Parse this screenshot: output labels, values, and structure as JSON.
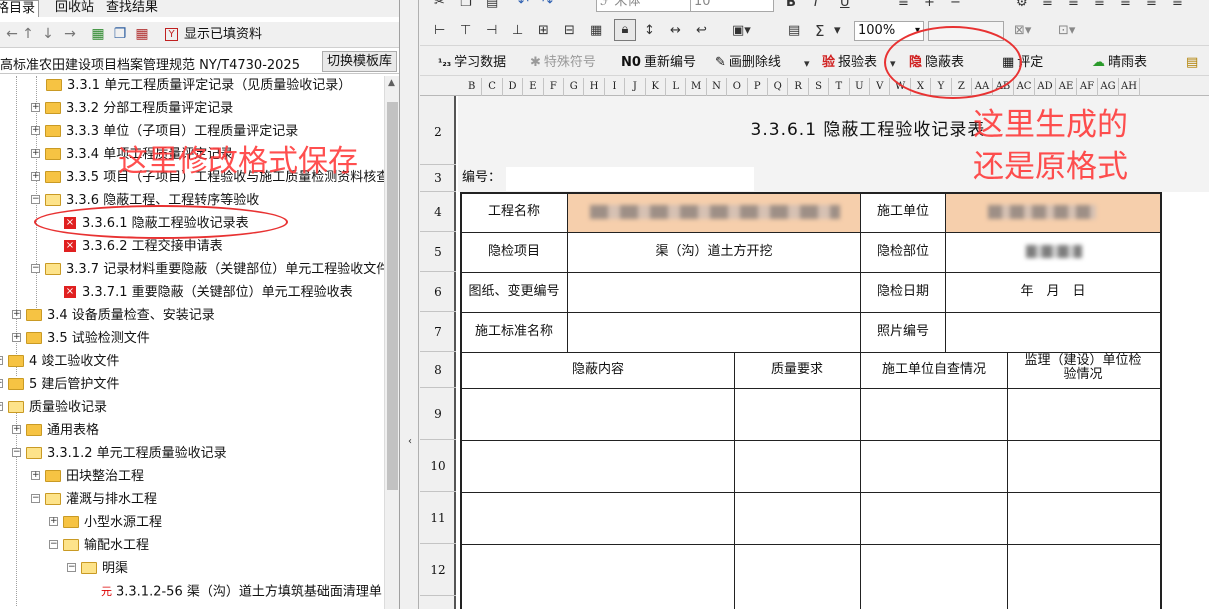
{
  "left_panel": {
    "tabs": [
      "格目录",
      "回收站",
      "查找结果"
    ],
    "show_filled_label": "显示已填资料",
    "standard": "高标准农田建设项目档案管理规范 NY/T4730-2025",
    "switch_template_label": "切换模板库",
    "tree": [
      "3.3.1 单元工程质量评定记录（见质量验收记录）",
      "3.3.2 分部工程质量评定记录",
      "3.3.3 单位（子项目）工程质量评定记录",
      "3.3.4 单项工程质量评定记录",
      "3.3.5 项目（子项目）工程验收与施工质量检测资料核查",
      "3.3.6 隐蔽工程、工程转序等验收",
      "3.3.6.1 隐蔽工程验收记录表",
      "3.3.6.2 工程交接申请表",
      "3.3.7 记录材料重要隐蔽（关键部位）单元工程验收文件",
      "3.3.7.1 重要隐蔽（关键部位）单元工程验收表",
      "3.4 设备质量检查、安装记录",
      "3.5 试验检测文件",
      "4 竣工验收文件",
      "5 建后管护文件",
      "质量验收记录",
      "通用表格",
      "3.3.1.2 单元工程质量验收记录",
      "田块整治工程",
      "灌溉与排水工程",
      "小型水源工程",
      "输配水工程",
      "明渠",
      "3.3.1.2-56 渠（沟）道土方填筑基础面清理单"
    ],
    "yuan_badge": "元",
    "annotation": "这里修改格式保存"
  },
  "toolbar": {
    "font_name": "宋体",
    "font_size": "10",
    "zoom": "100%",
    "sigma": "Σ",
    "buttons": [
      {
        "icon": "¹₂₃",
        "label": "学习数据"
      },
      {
        "icon": "✱",
        "label": "特殊符号"
      },
      {
        "icon": "N0",
        "label": "重新编号"
      },
      {
        "icon": "✎",
        "label": "画删除线"
      },
      {
        "icon": "验",
        "label": "报验表"
      },
      {
        "icon": "隐",
        "label": "隐蔽表"
      },
      {
        "icon": "▦",
        "label": "评定"
      },
      {
        "icon": "☁",
        "label": "晴雨表"
      }
    ]
  },
  "sheet": {
    "columns": [
      "B",
      "C",
      "D",
      "E",
      "F",
      "G",
      "H",
      "I",
      "J",
      "K",
      "L",
      "M",
      "N",
      "O",
      "P",
      "Q",
      "R",
      "S",
      "T",
      "U",
      "V",
      "W",
      "X",
      "Y",
      "Z",
      "AA",
      "AB",
      "AC",
      "AD",
      "AE",
      "AF",
      "AG",
      "AH"
    ],
    "rows": [
      "2",
      "3",
      "4",
      "5",
      "6",
      "7",
      "8",
      "9",
      "10",
      "11",
      "12"
    ],
    "title": "3.3.6.1 隐蔽工程验收记录表",
    "number_label": "编号：",
    "project_name_label": "工程名称",
    "construction_unit_label": "施工单位",
    "inspection_item_label": "隐检项目",
    "inspection_item_value": "渠（沟）道土方开挖",
    "inspection_part_label": "隐检部位",
    "drawing_label": "图纸、变更编号",
    "inspection_date_label": "隐检日期",
    "inspection_date_value": "年　月　日",
    "standard_name_label": "施工标准名称",
    "photo_no_label": "照片编号",
    "concealed_content_label": "隐蔽内容",
    "quality_req_label": "质量要求",
    "self_check_label": "施工单位自查情况",
    "supervision_label": "监理（建设）单位检验情况",
    "annotation": "这里生成的还是原格式"
  }
}
